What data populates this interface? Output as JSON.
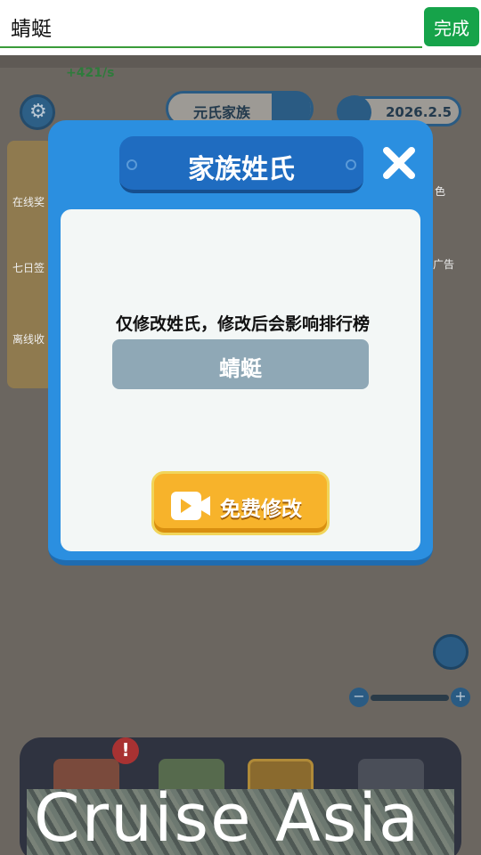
{
  "input_bar": {
    "value": "蜻蜓",
    "done_label": "完成"
  },
  "game": {
    "rate": "+421/s",
    "family_name": "元氏家族",
    "date": "2026.2.5",
    "left_labels": [
      "在线奖",
      "七日签",
      "离线收"
    ],
    "right_labels": [
      "色",
      "广告"
    ]
  },
  "modal": {
    "title": "家族姓氏",
    "hint": "仅修改姓氏，修改后会影响排行榜",
    "current_name": "蜻蜓",
    "button_label": "免费修改"
  },
  "ad": {
    "text": "Cruise Asia"
  },
  "colors": {
    "modal_blue": "#2b8fe0",
    "button_orange": "#f7b32b",
    "done_green": "#16a34a"
  }
}
